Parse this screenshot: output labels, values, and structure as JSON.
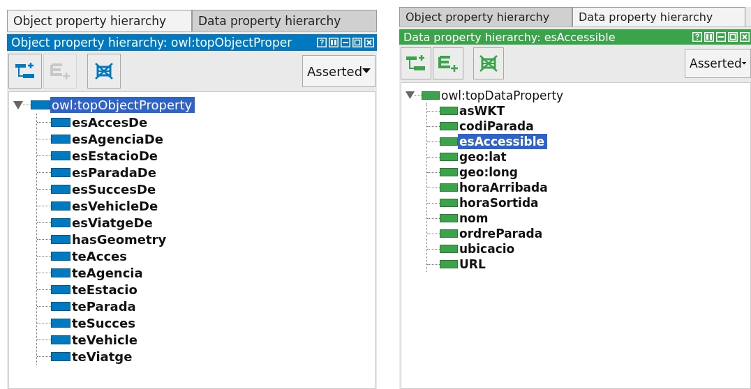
{
  "panels": [
    {
      "color": "#0079c1",
      "tabs": [
        {
          "label": "Object property hierarchy",
          "selected": true
        },
        {
          "label": "Data property hierarchy",
          "selected": false
        }
      ],
      "title": "Object property hierarchy: owl:topObjectProper",
      "toolbar": [
        {
          "kind": "add-sub",
          "disabled": false
        },
        {
          "kind": "add-sibling",
          "disabled": true
        },
        {
          "kind": "delete",
          "disabled": false
        }
      ],
      "view_mode": "Asserted",
      "tree": {
        "label": "owl:topObjectProperty",
        "selected": true,
        "expanded": true,
        "children": [
          {
            "label": "esAccesDe",
            "selected": false
          },
          {
            "label": "esAgenciaDe",
            "selected": false
          },
          {
            "label": "esEstacioDe",
            "selected": false
          },
          {
            "label": "esParadaDe",
            "selected": false
          },
          {
            "label": "esSuccesDe",
            "selected": false
          },
          {
            "label": "esVehicleDe",
            "selected": false
          },
          {
            "label": "esViatgeDe",
            "selected": false
          },
          {
            "label": "hasGeometry",
            "selected": false
          },
          {
            "label": "teAcces",
            "selected": false
          },
          {
            "label": "teAgencia",
            "selected": false
          },
          {
            "label": "teEstacio",
            "selected": false
          },
          {
            "label": "teParada",
            "selected": false
          },
          {
            "label": "teSucces",
            "selected": false
          },
          {
            "label": "teVehicle",
            "selected": false
          },
          {
            "label": "teViatge",
            "selected": false
          }
        ]
      }
    },
    {
      "color": "#3ba34a",
      "tabs": [
        {
          "label": "Object property hierarchy",
          "selected": false
        },
        {
          "label": "Data property hierarchy",
          "selected": true
        }
      ],
      "title": "Data property hierarchy: esAccessible",
      "toolbar": [
        {
          "kind": "add-sub",
          "disabled": false
        },
        {
          "kind": "add-sibling",
          "disabled": false
        },
        {
          "kind": "delete",
          "disabled": false
        }
      ],
      "view_mode": "Asserted",
      "tree": {
        "label": "owl:topDataProperty",
        "selected": false,
        "expanded": true,
        "children": [
          {
            "label": "asWKT",
            "selected": false
          },
          {
            "label": "codiParada",
            "selected": false
          },
          {
            "label": "esAccessible",
            "selected": true
          },
          {
            "label": "geo:lat",
            "selected": false
          },
          {
            "label": "geo:long",
            "selected": false
          },
          {
            "label": "horaArribada",
            "selected": false
          },
          {
            "label": "horaSortida",
            "selected": false
          },
          {
            "label": "nom",
            "selected": false
          },
          {
            "label": "ordreParada",
            "selected": false
          },
          {
            "label": "ubicacio",
            "selected": false
          },
          {
            "label": "URL",
            "selected": false
          }
        ]
      }
    }
  ]
}
